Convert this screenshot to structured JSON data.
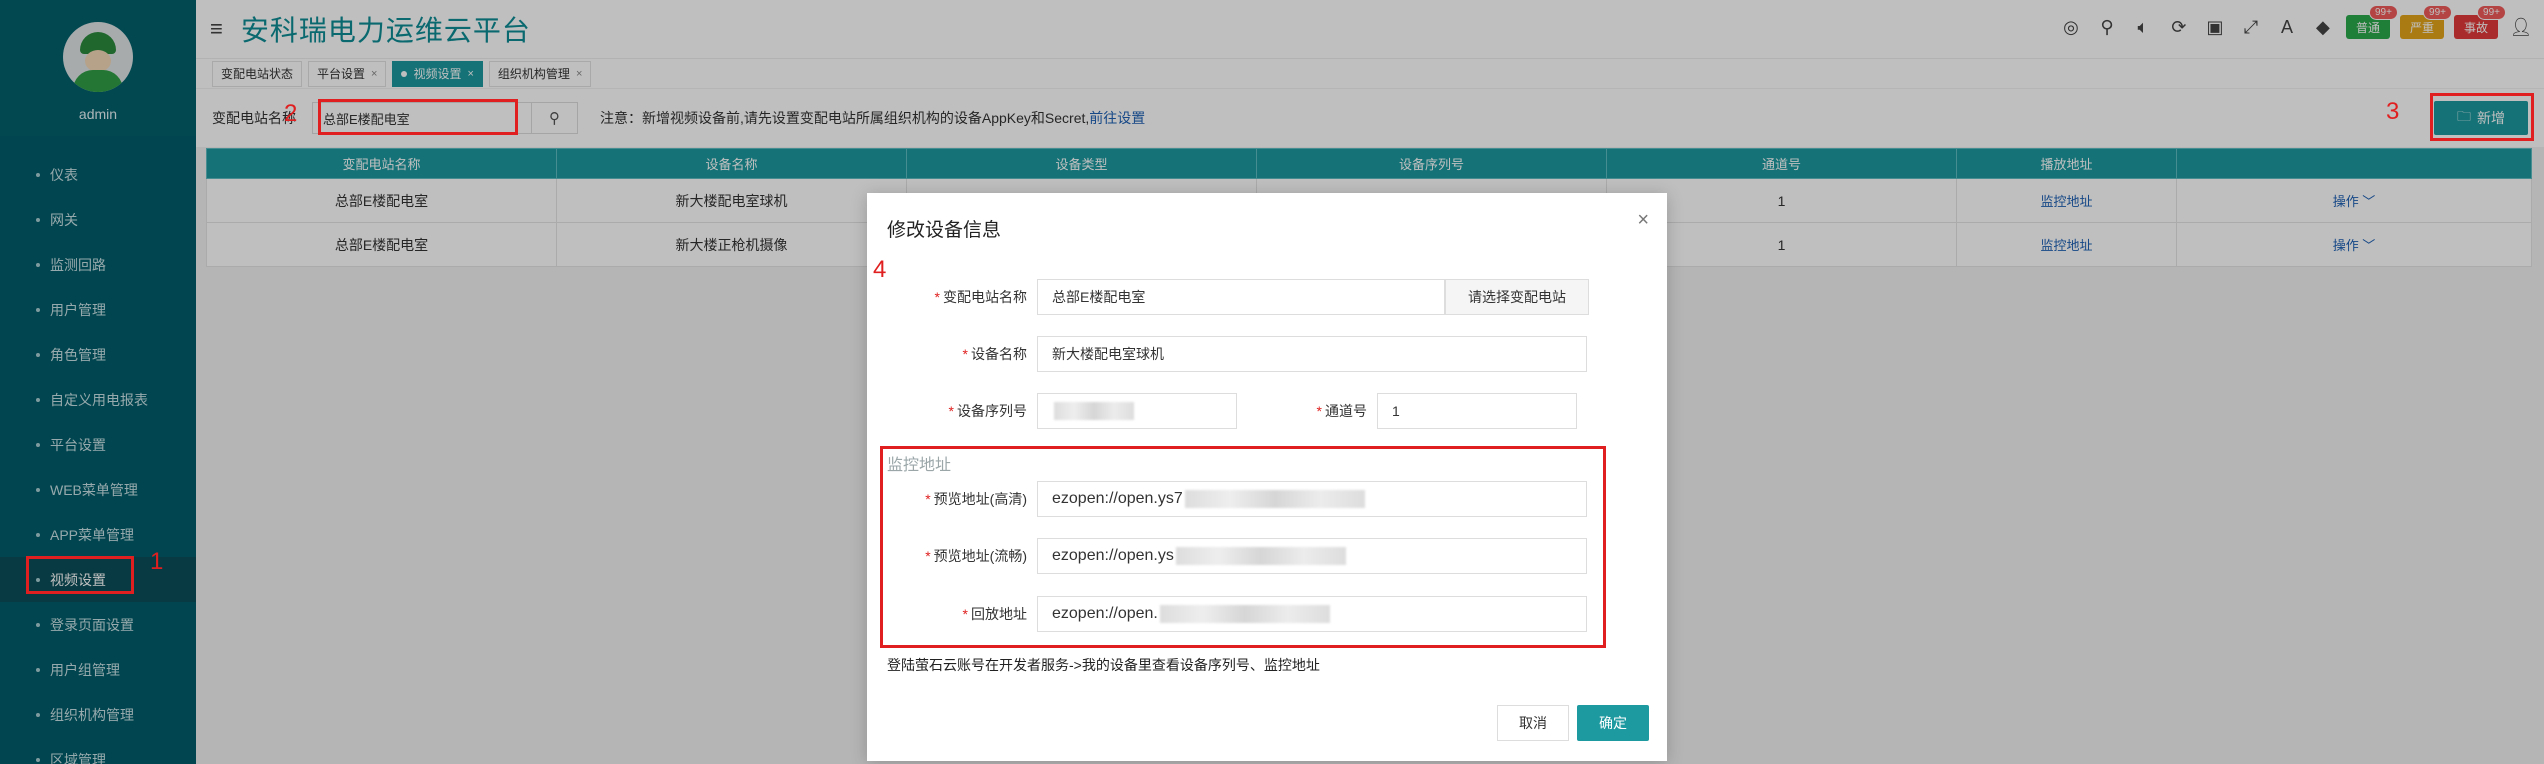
{
  "sidebar": {
    "username": "admin",
    "items": [
      {
        "label": "仪表"
      },
      {
        "label": "网关"
      },
      {
        "label": "监测回路"
      },
      {
        "label": "用户管理"
      },
      {
        "label": "角色管理"
      },
      {
        "label": "自定义用电报表"
      },
      {
        "label": "平台设置"
      },
      {
        "label": "WEB菜单管理"
      },
      {
        "label": "APP菜单管理"
      },
      {
        "label": "视频设置"
      },
      {
        "label": "登录页面设置"
      },
      {
        "label": "用户组管理"
      },
      {
        "label": "组织机构管理"
      },
      {
        "label": "区域管理"
      }
    ],
    "active_index": 9
  },
  "header": {
    "title": "安科瑞电力运维云平台",
    "badges": [
      {
        "label": "普通",
        "count": "99+",
        "color": "#2aa84a"
      },
      {
        "label": "严重",
        "count": "99+",
        "color": "#e3a51a"
      },
      {
        "label": "事故",
        "count": "99+",
        "color": "#e23a3a"
      }
    ]
  },
  "tabs": [
    {
      "label": "变配电站状态",
      "closable": false
    },
    {
      "label": "平台设置",
      "closable": true
    },
    {
      "label": "视频设置",
      "closable": true,
      "active": true
    },
    {
      "label": "组织机构管理",
      "closable": true
    }
  ],
  "filter": {
    "label": "变配电站名称",
    "value": "总部E楼配电室",
    "note_prefix": "注意：新增视频设备前,请先设置变配电站所属组织机构的设备AppKey和Secret,",
    "note_link": "前往设置",
    "add_label": "新增"
  },
  "table": {
    "headers": [
      "变配电站名称",
      "设备名称",
      "设备类型",
      "设备序列号",
      "通道号",
      "播放地址",
      ""
    ],
    "rows": [
      {
        "station": "总部E楼配电室",
        "device": "新大楼配电室球机",
        "channel": "1",
        "play": "监控地址",
        "ops": "操作 ﹀"
      },
      {
        "station": "总部E楼配电室",
        "device": "新大楼正枪机摄像",
        "channel": "1",
        "play": "监控地址",
        "ops": "操作 ﹀"
      }
    ]
  },
  "modal": {
    "title": "修改设备信息",
    "station_label": "变配电站名称",
    "station_value": "总部E楼配电室",
    "select_station_btn": "请选择变配电站",
    "device_label": "设备名称",
    "device_value": "新大楼配电室球机",
    "serial_label": "设备序列号",
    "channel_label": "通道号",
    "channel_value": "1",
    "section_title": "监控地址",
    "preview_hd_label": "预览地址(高清)",
    "preview_hd_value": "ezopen://open.ys7",
    "preview_smooth_label": "预览地址(流畅)",
    "preview_smooth_value": "ezopen://open.ys",
    "playback_label": "回放地址",
    "playback_value": "ezopen://open.",
    "hint": "登陆萤石云账号在开发者服务->我的设备里查看设备序列号、监控地址",
    "cancel": "取消",
    "confirm": "确定"
  },
  "annotations": [
    "1",
    "2",
    "3",
    "4"
  ]
}
